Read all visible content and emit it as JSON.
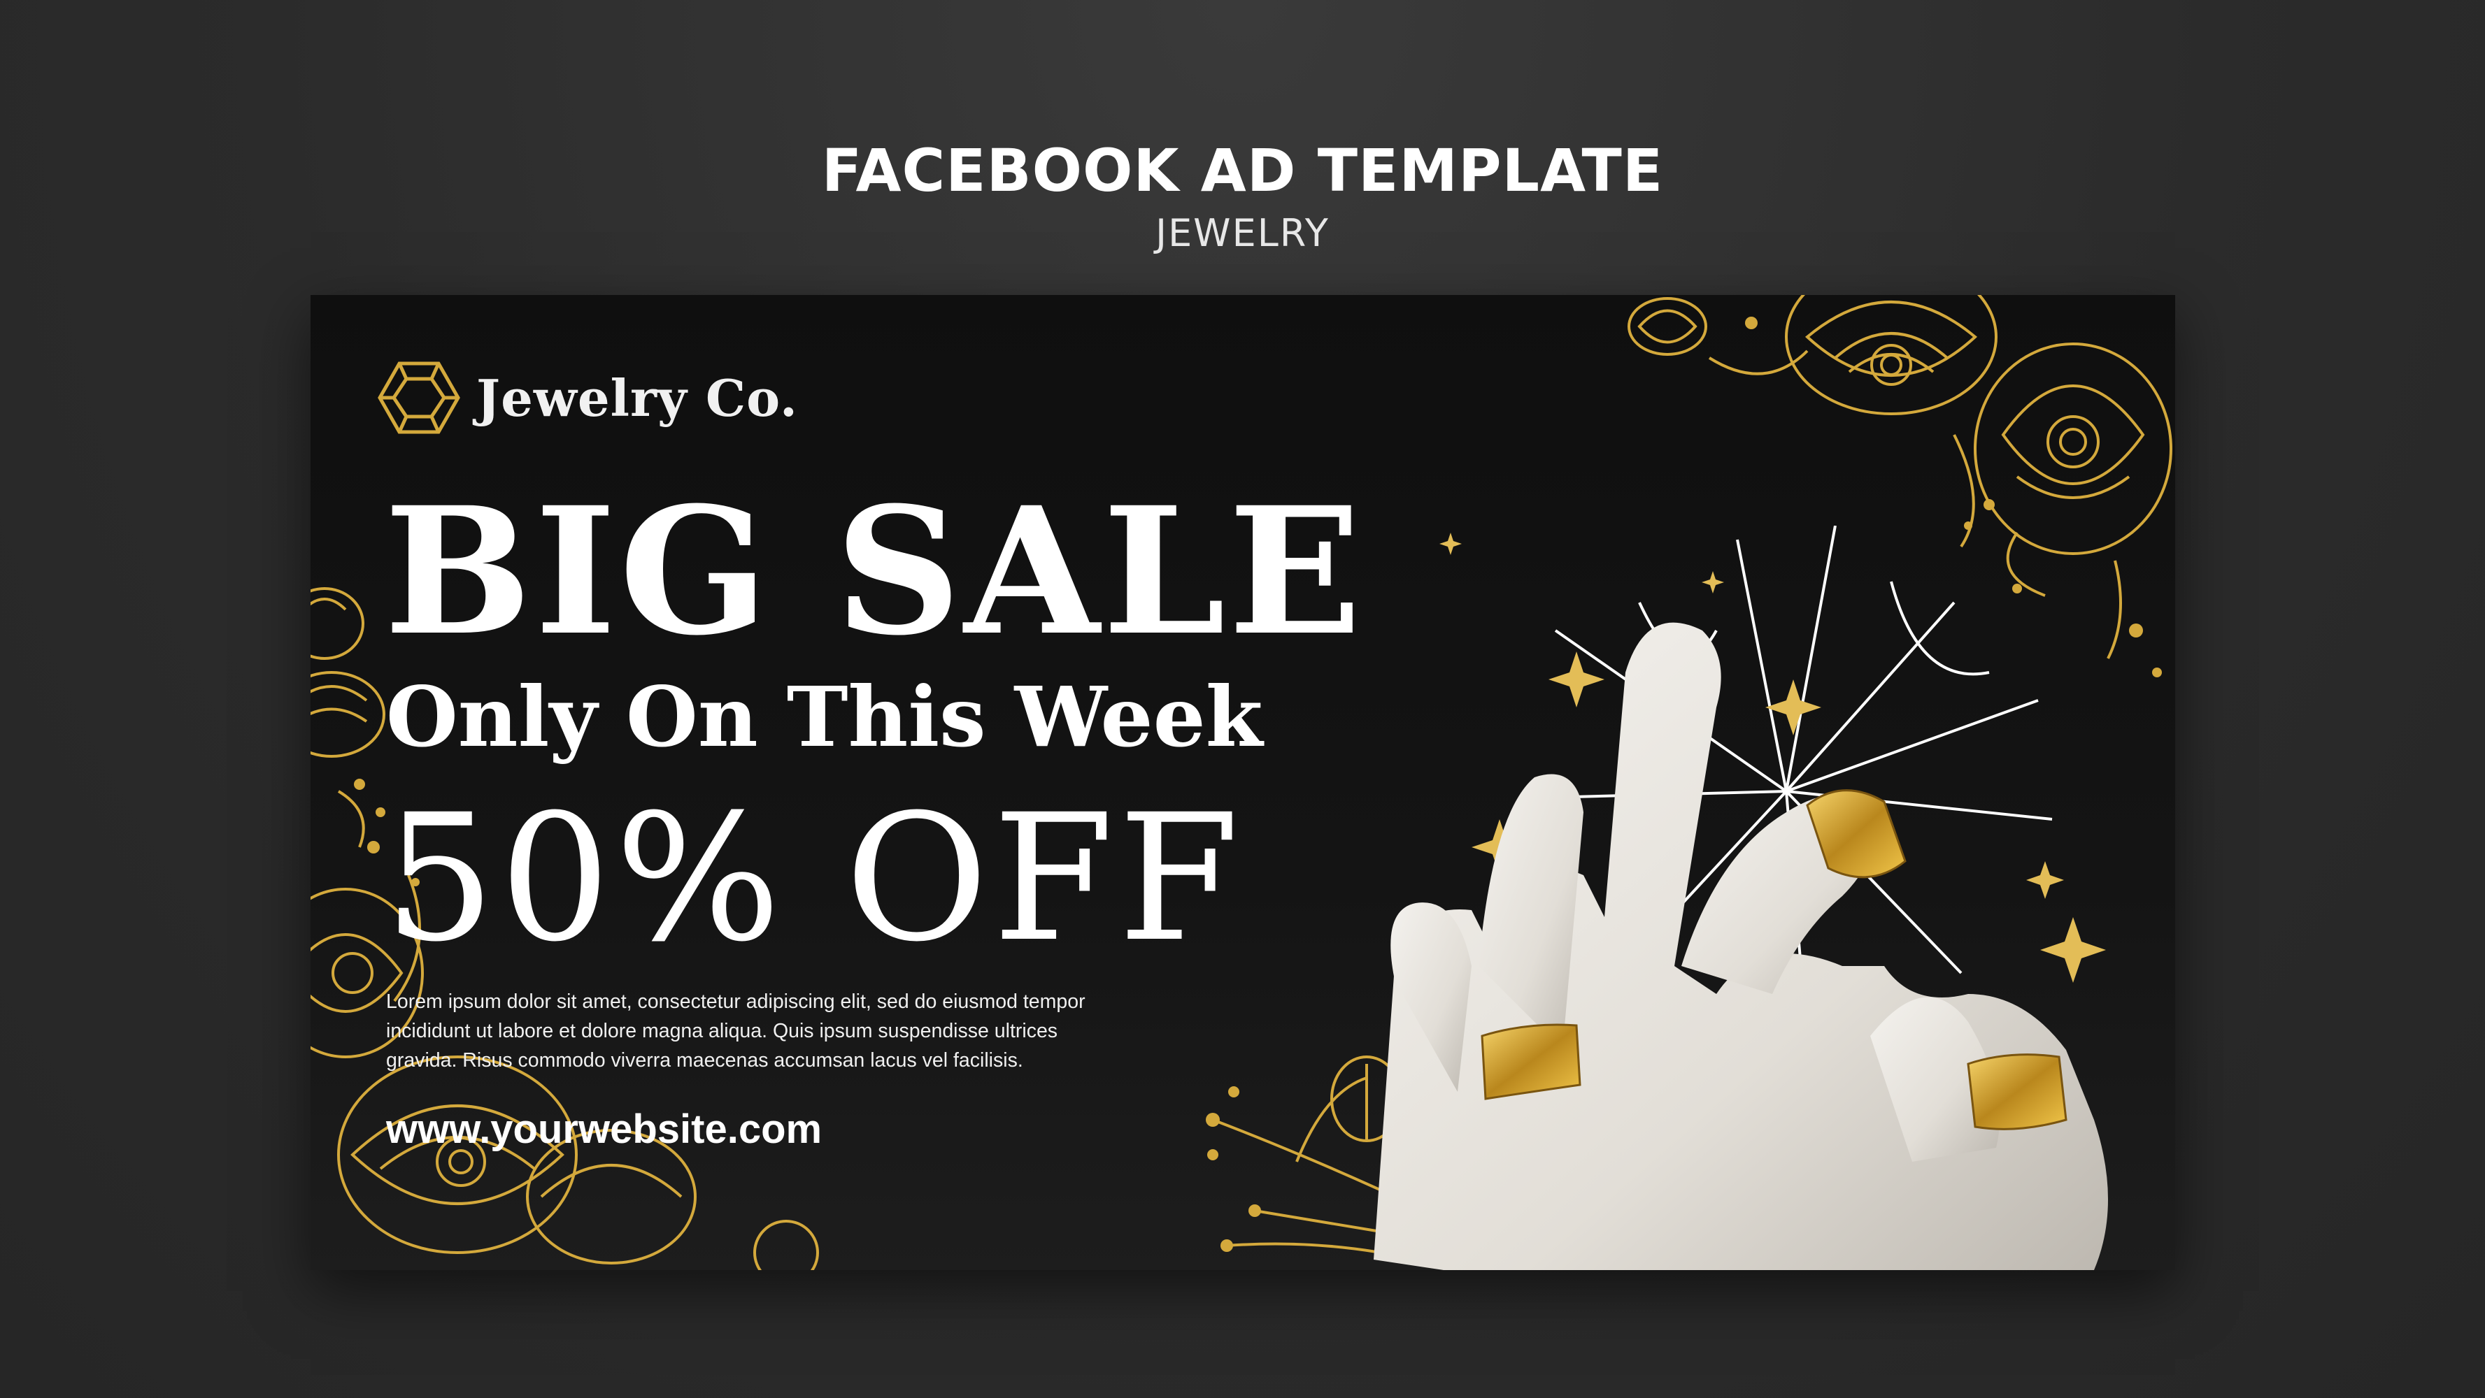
{
  "header": {
    "title": "FACEBOOK AD TEMPLATE",
    "subtitle": "JEWELRY"
  },
  "ad": {
    "brand": {
      "name": "Jewelry Co.",
      "logo_icon": "hexagon-gem-icon"
    },
    "headline": "BIG SALE",
    "subheadline": "Only On This Week",
    "discount": "50% OFF",
    "body": "Lorem ipsum dolor sit amet, consectetur adipiscing elit, sed do eiusmod tempor incididunt ut labore et dolore magna aliqua. Quis ipsum suspendisse ultrices gravida. Risus commodo viverra maecenas accumsan lacus vel facilisis.",
    "website": "www.yourwebsite.com",
    "image": {
      "subject": "white-hand-sculpture-with-gold-rings",
      "accent_color": "#d4a93c",
      "decoration_icons": [
        "gold-floral-icon",
        "sparkle-star-icon",
        "burst-lines-icon"
      ]
    }
  },
  "colors": {
    "page_background": "#2b2b2b",
    "card_background": "#111111",
    "gold": "#d4a93c",
    "text": "#ffffff"
  }
}
